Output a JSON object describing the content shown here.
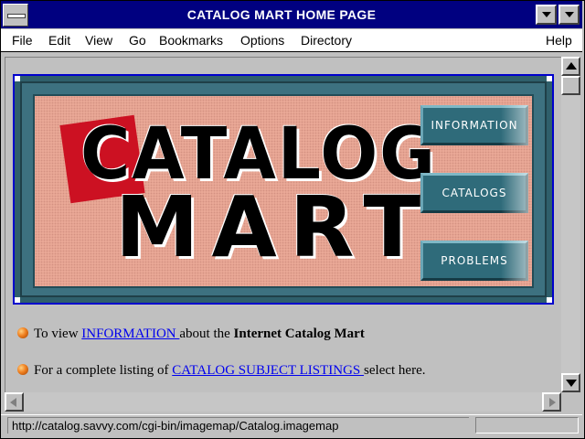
{
  "window": {
    "title": "CATALOG MART HOME PAGE"
  },
  "menubar": {
    "items": [
      {
        "label": "File"
      },
      {
        "label": "Edit"
      },
      {
        "label": "View"
      },
      {
        "label": "Go"
      },
      {
        "label": "Bookmarks"
      },
      {
        "label": "Options"
      },
      {
        "label": "Directory"
      },
      {
        "label": "Help"
      }
    ]
  },
  "banner": {
    "logo_line1": "CATALOG",
    "logo_line2": "MART",
    "buttons": [
      {
        "label": "INFORMATION"
      },
      {
        "label": "CATALOGS"
      },
      {
        "label": "PROBLEMS"
      }
    ]
  },
  "content": {
    "line1": {
      "prefix": "To view ",
      "link": "INFORMATION ",
      "middle": "about the ",
      "bold": "Internet Catalog Mart"
    },
    "line2": {
      "prefix": "For a complete listing of ",
      "link": "CATALOG SUBJECT LISTINGS ",
      "suffix": "select here."
    }
  },
  "statusbar": {
    "url": "http://catalog.savvy.com/cgi-bin/imagemap/Catalog.imagemap"
  },
  "colors": {
    "titlebar": "#000080",
    "chrome": "#c0c0c0",
    "link": "#0000ee",
    "banner_face": "#e9a896",
    "banner_frame": "#3d7180",
    "logo_accent": "#cc1122"
  },
  "icons": [
    "system-menu-icon",
    "minimize-icon",
    "maximize-icon",
    "scroll-up-icon",
    "scroll-down-icon",
    "scroll-left-icon",
    "scroll-right-icon",
    "bullet-icon"
  ]
}
